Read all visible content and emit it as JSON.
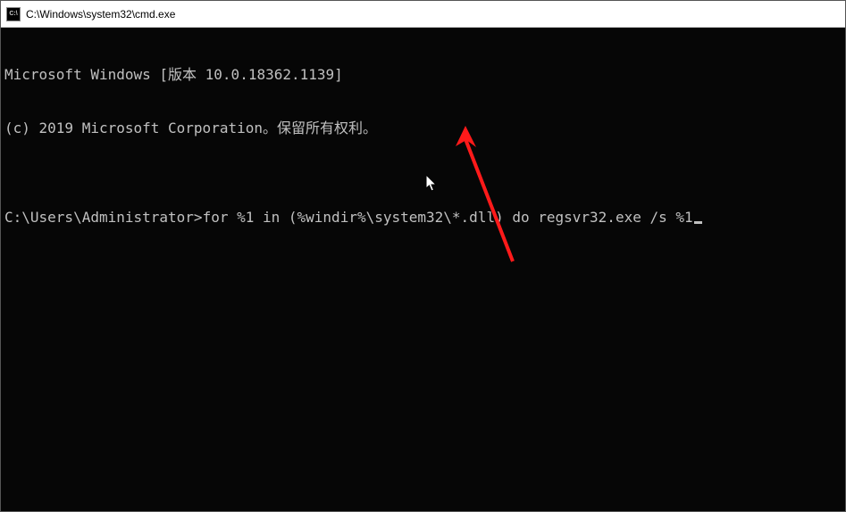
{
  "titlebar": {
    "icon_label": "C:\\",
    "title": "C:\\Windows\\system32\\cmd.exe"
  },
  "terminal": {
    "line1": "Microsoft Windows [版本 10.0.18362.1139]",
    "line2": "(c) 2019 Microsoft Corporation。保留所有权利。",
    "blank": "",
    "prompt": "C:\\Users\\Administrator>",
    "command": "for %1 in (%windir%\\system32\\*.dll) do regsvr32.exe /s %1"
  },
  "annotation": {
    "arrow_color": "#ff1a1a"
  }
}
